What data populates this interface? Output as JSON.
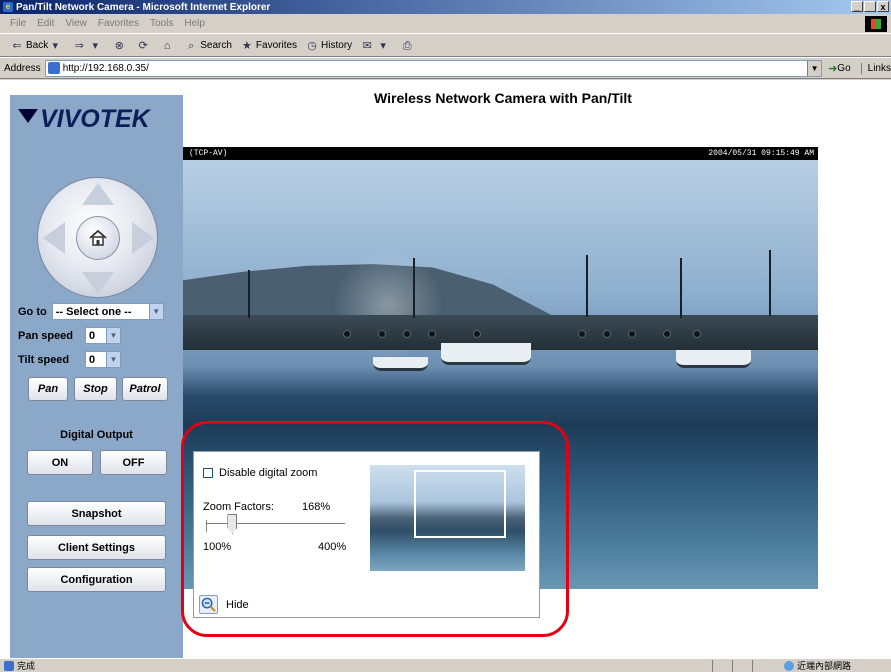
{
  "window": {
    "title": "Pan/Tilt Network Camera - Microsoft Internet Explorer",
    "controls": [
      "_",
      " ",
      "x"
    ]
  },
  "menu": [
    "File",
    "Edit",
    "View",
    "Favorites",
    "Tools",
    "Help"
  ],
  "toolbar": {
    "back": "Back",
    "search": "Search",
    "favorites": "Favorites",
    "history": "History"
  },
  "address": {
    "label": "Address",
    "url": "http://192.168.0.35/",
    "go": "Go",
    "links": "Links"
  },
  "brand": {
    "logo_text": "VIVOTEK"
  },
  "page": {
    "title": "Wireless Network Camera with Pan/Tilt"
  },
  "ptz": {
    "goto_label": "Go to",
    "goto_value": "-- Select one --",
    "pan_speed_label": "Pan speed",
    "pan_speed_value": "0",
    "tilt_speed_label": "Tilt speed",
    "tilt_speed_value": "0",
    "pan_btn": "Pan",
    "stop_btn": "Stop",
    "patrol_btn": "Patrol"
  },
  "digital_output": {
    "label": "Digital Output",
    "on": "ON",
    "off": "OFF"
  },
  "actions": {
    "snapshot": "Snapshot",
    "client_settings": "Client Settings",
    "configuration": "Configuration"
  },
  "video": {
    "label": "(TCP-AV)",
    "timestamp": "2004/05/31 09:15:49 AM"
  },
  "zoom": {
    "disable_label": "Disable digital zoom",
    "factor_label": "Zoom Factors:",
    "factor_value": "168%",
    "min": "100%",
    "max": "400%",
    "slider_fraction": 0.19,
    "hide_label": "Hide"
  },
  "status": {
    "done": "完成",
    "zone": "近端內部網路"
  },
  "colors": {
    "sidebar": "#8ca8c9",
    "highlight_outline": "#e30010",
    "title_bar": "#0a246a"
  }
}
